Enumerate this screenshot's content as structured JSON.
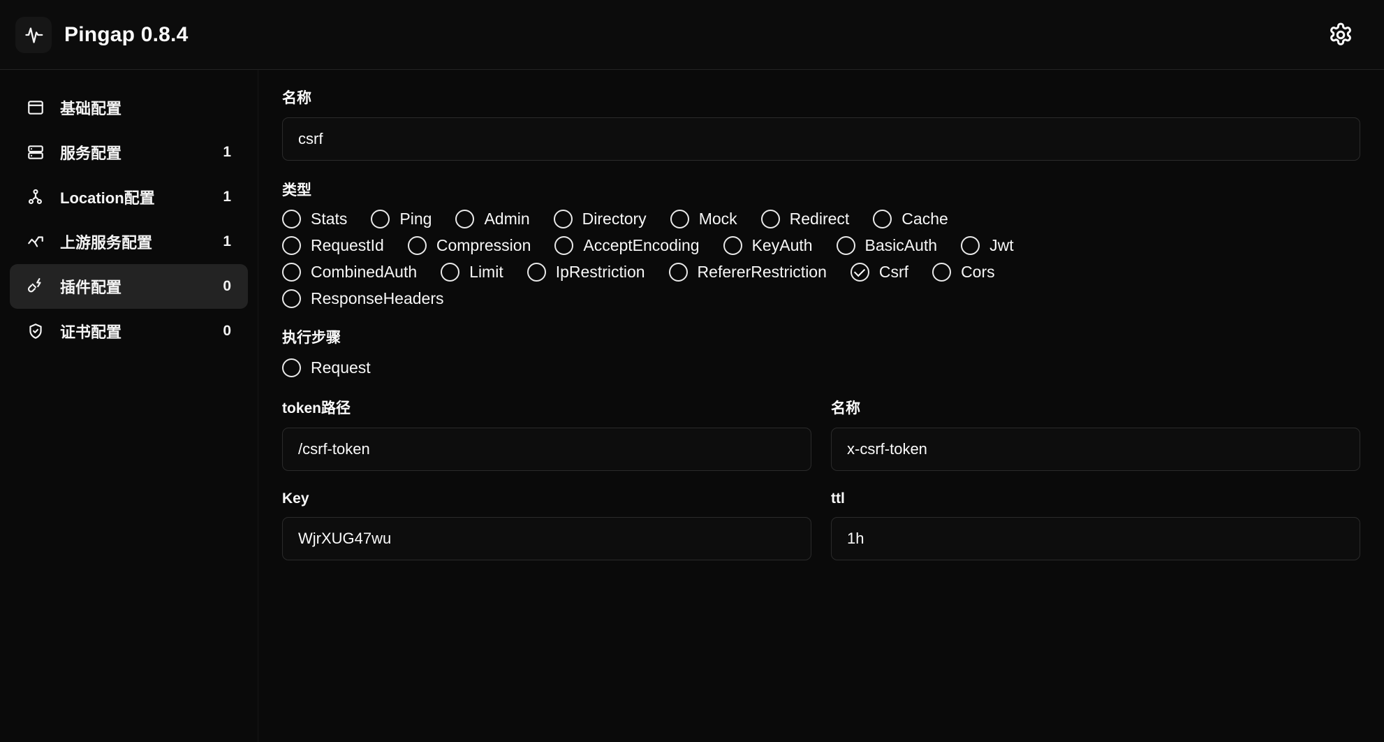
{
  "header": {
    "logo_icon": "activity-pulse-icon",
    "title": "Pingap  0.8.4",
    "settings_icon": "gear-icon"
  },
  "sidebar": {
    "items": [
      {
        "icon": "window-layout-icon",
        "label": "基础配置",
        "count": "",
        "active": false
      },
      {
        "icon": "server-icon",
        "label": "服务配置",
        "count": "1",
        "active": false
      },
      {
        "icon": "share-nodes-icon",
        "label": "Location配置",
        "count": "1",
        "active": false
      },
      {
        "icon": "trending-up-icon",
        "label": "上游服务配置",
        "count": "1",
        "active": false
      },
      {
        "icon": "plug-zap-icon",
        "label": "插件配置",
        "count": "0",
        "active": true
      },
      {
        "icon": "shield-check-icon",
        "label": "证书配置",
        "count": "0",
        "active": false
      }
    ]
  },
  "main": {
    "name_field": {
      "label": "名称",
      "value": "csrf",
      "placeholder": ""
    },
    "type_section": {
      "label": "类型",
      "rows": [
        [
          {
            "label": "Stats",
            "checked": false
          },
          {
            "label": "Ping",
            "checked": false
          },
          {
            "label": "Admin",
            "checked": false
          },
          {
            "label": "Directory",
            "checked": false
          },
          {
            "label": "Mock",
            "checked": false
          },
          {
            "label": "Redirect",
            "checked": false
          },
          {
            "label": "Cache",
            "checked": false
          }
        ],
        [
          {
            "label": "RequestId",
            "checked": false
          },
          {
            "label": "Compression",
            "checked": false
          },
          {
            "label": "AcceptEncoding",
            "checked": false
          },
          {
            "label": "KeyAuth",
            "checked": false
          },
          {
            "label": "BasicAuth",
            "checked": false
          },
          {
            "label": "Jwt",
            "checked": false
          }
        ],
        [
          {
            "label": "CombinedAuth",
            "checked": false
          },
          {
            "label": "Limit",
            "checked": false
          },
          {
            "label": "IpRestriction",
            "checked": false
          },
          {
            "label": "RefererRestriction",
            "checked": false
          },
          {
            "label": "Csrf",
            "checked": true
          },
          {
            "label": "Cors",
            "checked": false
          }
        ],
        [
          {
            "label": "ResponseHeaders",
            "checked": false
          }
        ]
      ]
    },
    "steps_section": {
      "label": "执行步骤",
      "rows": [
        [
          {
            "label": "Request",
            "checked": false
          }
        ]
      ]
    },
    "token_path_field": {
      "label": "token路径",
      "value": "/csrf-token",
      "placeholder": ""
    },
    "token_name_field": {
      "label": "名称",
      "value": "x-csrf-token",
      "placeholder": ""
    },
    "key_field": {
      "label": "Key",
      "value": "WjrXUG47wu",
      "placeholder": ""
    },
    "ttl_field": {
      "label": "ttl",
      "value": "1h",
      "placeholder": ""
    }
  },
  "colors": {
    "background": "#0a0a0a",
    "panel": "#0c0c0c",
    "active_nav": "#232323",
    "text": "#fafafa",
    "border": "#2b2b2b"
  }
}
